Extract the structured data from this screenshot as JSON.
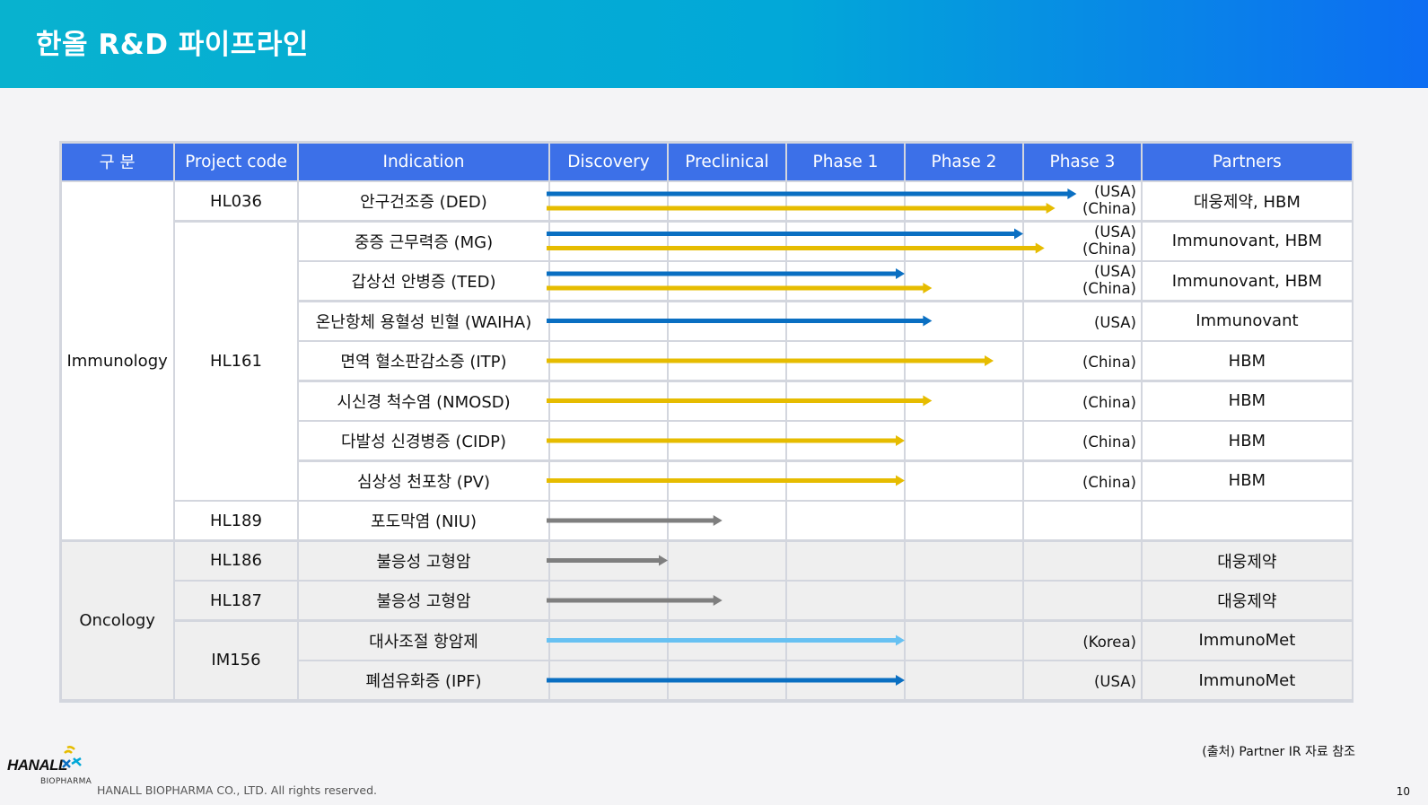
{
  "title": "한올 R&D 파이프라인",
  "table": {
    "headers": {
      "category": "구 분",
      "code": "Project  code",
      "indication": "Indication",
      "discovery": "Discovery",
      "preclinical": "Preclinical",
      "phase1": "Phase 1",
      "phase2": "Phase 2",
      "phase3": "Phase 3",
      "partners": "Partners"
    },
    "categories": {
      "immunology": "Immunology",
      "oncology": "Oncology"
    },
    "codes": {
      "hl036": "HL036",
      "hl161": "HL161",
      "hl189": "HL189",
      "hl186": "HL186",
      "hl187": "HL187",
      "im156": "IM156"
    },
    "rows": [
      {
        "indication": "안구건조증 (DED)",
        "regions": [
          "(USA)",
          "(China)"
        ],
        "partners": "대웅제약, HBM"
      },
      {
        "indication": "중증 근무력증 (MG)",
        "regions": [
          "(USA)",
          "(China)"
        ],
        "partners": "Immunovant, HBM"
      },
      {
        "indication": "갑상선 안병증 (TED)",
        "regions": [
          "(USA)",
          "(China)"
        ],
        "partners": "Immunovant, HBM"
      },
      {
        "indication": "온난항체 용혈성 빈혈 (WAIHA)",
        "regions": [
          "(USA)"
        ],
        "partners": "Immunovant"
      },
      {
        "indication": "면역 혈소판감소증 (ITP)",
        "regions": [
          "(China)"
        ],
        "partners": "HBM"
      },
      {
        "indication": "시신경 척수염 (NMOSD)",
        "regions": [
          "(China)"
        ],
        "partners": "HBM"
      },
      {
        "indication": "다발성 신경병증 (CIDP)",
        "regions": [
          "(China)"
        ],
        "partners": "HBM"
      },
      {
        "indication": "심상성 천포창 (PV)",
        "regions": [
          "(China)"
        ],
        "partners": "HBM"
      },
      {
        "indication": "포도막염 (NIU)",
        "regions": [],
        "partners": ""
      },
      {
        "indication": "불응성 고형암",
        "regions": [],
        "partners": "대웅제약"
      },
      {
        "indication": "불응성 고형암",
        "regions": [],
        "partners": "대웅제약"
      },
      {
        "indication": "대사조절 항암제",
        "regions": [
          "(Korea)"
        ],
        "partners": "ImmunoMet"
      },
      {
        "indication": "폐섬유화증 (IPF)",
        "regions": [
          "(USA)"
        ],
        "partners": "ImmunoMet"
      }
    ],
    "progress": [
      {
        "row": 0,
        "color": "#0a6fc2",
        "end_stage": 4.45
      },
      {
        "row": 0,
        "color": "#e6bc00",
        "end_stage": 4.27
      },
      {
        "row": 1,
        "color": "#0a6fc2",
        "end_stage": 4.0
      },
      {
        "row": 1,
        "color": "#e6bc00",
        "end_stage": 4.18
      },
      {
        "row": 2,
        "color": "#0a6fc2",
        "end_stage": 3.0
      },
      {
        "row": 2,
        "color": "#e6bc00",
        "end_stage": 3.23
      },
      {
        "row": 3,
        "color": "#0a6fc2",
        "end_stage": 3.23
      },
      {
        "row": 4,
        "color": "#e6bc00",
        "end_stage": 3.75
      },
      {
        "row": 5,
        "color": "#e6bc00",
        "end_stage": 3.23
      },
      {
        "row": 6,
        "color": "#e6bc00",
        "end_stage": 3.0
      },
      {
        "row": 7,
        "color": "#e6bc00",
        "end_stage": 3.0
      },
      {
        "row": 8,
        "color": "#7f7f7f",
        "end_stage": 1.46
      },
      {
        "row": 9,
        "color": "#7f7f7f",
        "end_stage": 1.0
      },
      {
        "row": 10,
        "color": "#7f7f7f",
        "end_stage": 1.46
      },
      {
        "row": 11,
        "color": "#67c1f2",
        "end_stage": 3.0
      },
      {
        "row": 12,
        "color": "#0a6fc2",
        "end_stage": 3.0
      }
    ]
  },
  "source_note": "(출처) Partner IR 자료 참조",
  "footer": {
    "logo_text": "HANALL",
    "logo_sub": "BIOPHARMA",
    "copyright": "HANALL BIOPHARMA CO., LTD. All rights reserved.",
    "page": "10"
  }
}
